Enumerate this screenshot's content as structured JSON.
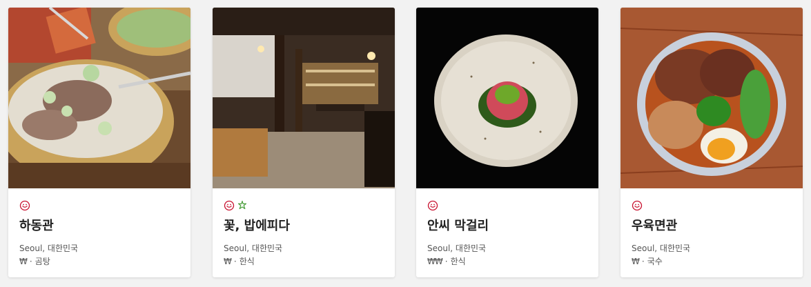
{
  "colors": {
    "award_red": "#c8102e",
    "award_green": "#4a9e3b",
    "text_primary": "#222222",
    "text_secondary": "#555555"
  },
  "cards": [
    {
      "name": "하동관",
      "location": "Seoul, 대한민국",
      "price": "₩",
      "separator": "·",
      "cuisine": "곰탕",
      "awards": [
        "bib-gourmand-icon"
      ],
      "image": "gomtang-beef-soup-photo"
    },
    {
      "name": "꽃, 밥에피다",
      "location": "Seoul, 대한민국",
      "price": "₩",
      "separator": "·",
      "cuisine": "한식",
      "awards": [
        "bib-gourmand-icon",
        "green-star-icon"
      ],
      "image": "restaurant-interior-photo"
    },
    {
      "name": "안씨 막걸리",
      "location": "Seoul, 대한민국",
      "price": "₩₩",
      "separator": "·",
      "cuisine": "한식",
      "awards": [
        "bib-gourmand-icon"
      ],
      "image": "beef-tartare-plate-photo"
    },
    {
      "name": "우육면관",
      "location": "Seoul, 대한민국",
      "price": "₩",
      "separator": "·",
      "cuisine": "국수",
      "awards": [
        "bib-gourmand-icon"
      ],
      "image": "beef-noodle-soup-photo"
    }
  ]
}
